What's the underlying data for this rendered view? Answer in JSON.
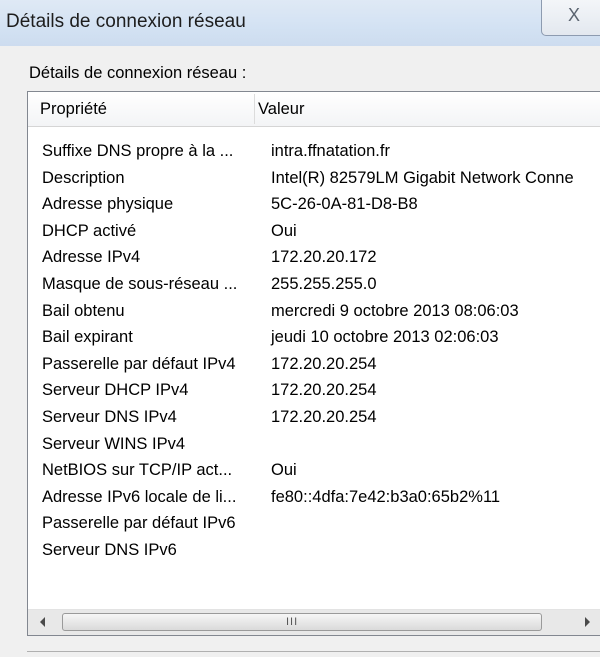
{
  "window": {
    "title": "Détails de connexion réseau",
    "close_glyph": "X"
  },
  "section_label": "Détails de connexion réseau :",
  "columns": {
    "property": "Propriété",
    "value": "Valeur"
  },
  "rows": [
    {
      "property": "Suffixe DNS propre à la ...",
      "value": "intra.ffnatation.fr"
    },
    {
      "property": "Description",
      "value": "Intel(R) 82579LM Gigabit Network Conne"
    },
    {
      "property": "Adresse physique",
      "value": "5C-26-0A-81-D8-B8"
    },
    {
      "property": "DHCP activé",
      "value": "Oui"
    },
    {
      "property": "Adresse IPv4",
      "value": "172.20.20.172"
    },
    {
      "property": "Masque de sous-réseau ...",
      "value": "255.255.255.0"
    },
    {
      "property": "Bail obtenu",
      "value": "mercredi 9 octobre 2013 08:06:03"
    },
    {
      "property": "Bail expirant",
      "value": "jeudi 10 octobre 2013 02:06:03"
    },
    {
      "property": "Passerelle par défaut IPv4",
      "value": "172.20.20.254"
    },
    {
      "property": "Serveur DHCP IPv4",
      "value": "172.20.20.254"
    },
    {
      "property": "Serveur DNS IPv4",
      "value": "172.20.20.254"
    },
    {
      "property": "Serveur WINS IPv4",
      "value": ""
    },
    {
      "property": "NetBIOS sur TCP/IP act...",
      "value": "Oui"
    },
    {
      "property": "Adresse IPv6 locale de li...",
      "value": "fe80::4dfa:7e42:b3a0:65b2%11"
    },
    {
      "property": "Passerelle par défaut IPv6",
      "value": ""
    },
    {
      "property": "Serveur DNS IPv6",
      "value": ""
    }
  ],
  "scrollbar": {
    "grip_glyph": "III"
  }
}
